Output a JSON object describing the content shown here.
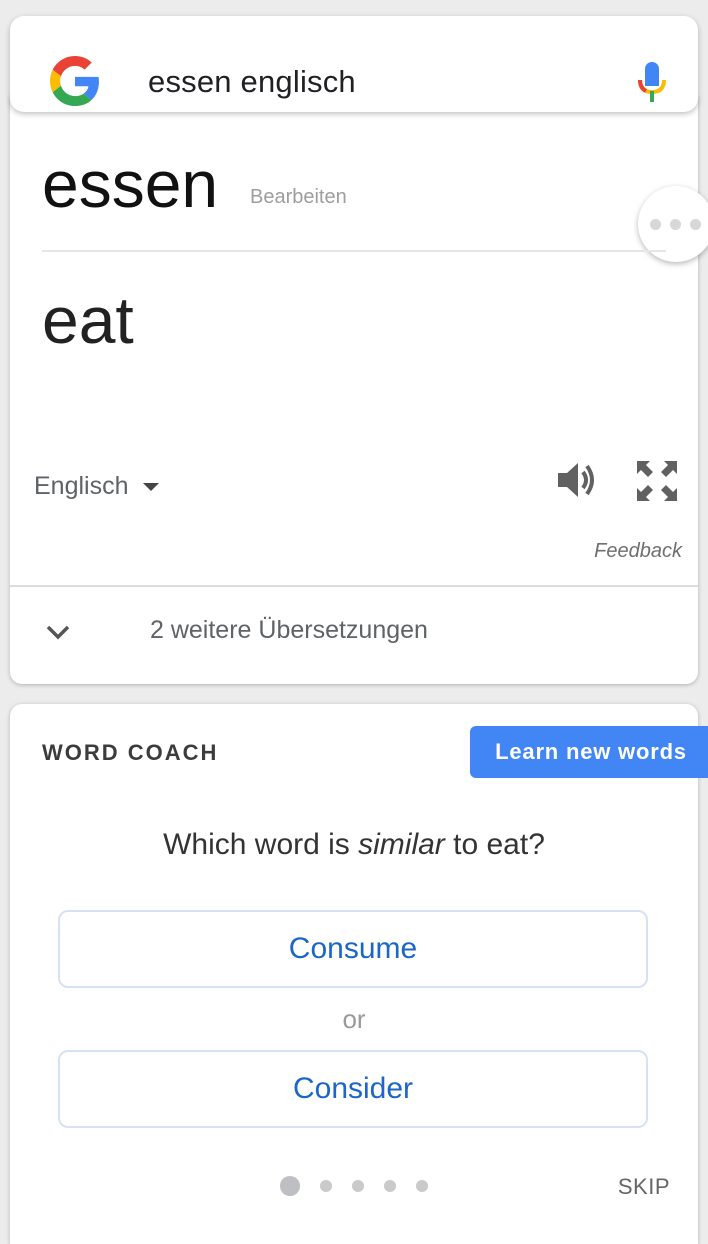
{
  "search": {
    "query": "essen englisch"
  },
  "translation": {
    "source_word": "essen",
    "edit_label": "Bearbeiten",
    "target_word": "eat",
    "target_language": "Englisch",
    "feedback_label": "Feedback",
    "more_translations": "2 weitere Übersetzungen"
  },
  "word_coach": {
    "title": "WORD COACH",
    "learn_button": "Learn new words",
    "question_prefix": "Which word is ",
    "question_emphasis": "similar",
    "question_suffix": " to eat?",
    "choices": [
      "Consume",
      "Consider"
    ],
    "or_label": "or",
    "skip_label": "SKIP",
    "progress": {
      "current": 1,
      "total": 5
    }
  },
  "icons": {
    "logo": "google-g-logo",
    "mic": "microphone-icon",
    "more": "more-options-icon",
    "dropdown": "caret-down-icon",
    "speaker": "speaker-icon",
    "fullscreen": "fullscreen-icon",
    "expand": "chevron-down-icon"
  },
  "colors": {
    "accent": "#4285f4",
    "choice_text": "#1a66c9",
    "google_blue": "#4285F4",
    "google_red": "#EA4335",
    "google_yellow": "#FBBC05",
    "google_green": "#34A853"
  }
}
